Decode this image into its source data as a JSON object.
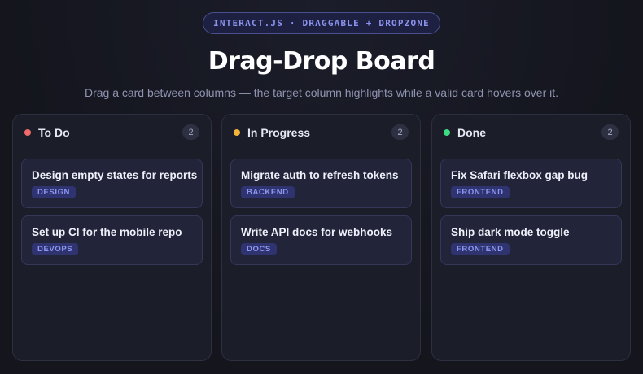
{
  "header": {
    "pill": "INTERACT.JS · DRAGGABLE + DROPZONE",
    "title": "Drag-Drop Board",
    "subtitle": "Drag a card between columns — the target column highlights while a valid card hovers over it."
  },
  "columns": [
    {
      "title": "To Do",
      "count": "2",
      "dot_color": "#f26b6b",
      "cards": [
        {
          "title": "Design empty states for reports",
          "tag": "DESIGN"
        },
        {
          "title": "Set up CI for the mobile repo",
          "tag": "DEVOPS"
        }
      ]
    },
    {
      "title": "In Progress",
      "count": "2",
      "dot_color": "#f2b43a",
      "cards": [
        {
          "title": "Migrate auth to refresh tokens",
          "tag": "BACKEND"
        },
        {
          "title": "Write API docs for webhooks",
          "tag": "DOCS"
        }
      ]
    },
    {
      "title": "Done",
      "count": "2",
      "dot_color": "#3ddc84",
      "cards": [
        {
          "title": "Fix Safari flexbox gap bug",
          "tag": "FRONTEND"
        },
        {
          "title": "Ship dark mode toggle",
          "tag": "FRONTEND"
        }
      ]
    }
  ]
}
